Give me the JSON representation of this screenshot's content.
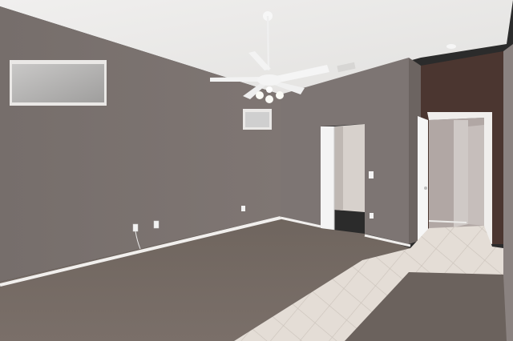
{
  "scene": {
    "kind": "photo",
    "subject": "empty-room-interior",
    "colors": {
      "wall": "#7b726f",
      "wall_shadow": "#6e6663",
      "accent_wall": "#4b3630",
      "ceiling": "#ecebea",
      "carpet": "#6d625c",
      "tile": "#e3dbd3",
      "trim": "#f3f2f0",
      "door": "#f4f4f4"
    },
    "icons": [
      "ceiling-fan-icon",
      "outlet-icon",
      "light-switch-icon"
    ]
  }
}
